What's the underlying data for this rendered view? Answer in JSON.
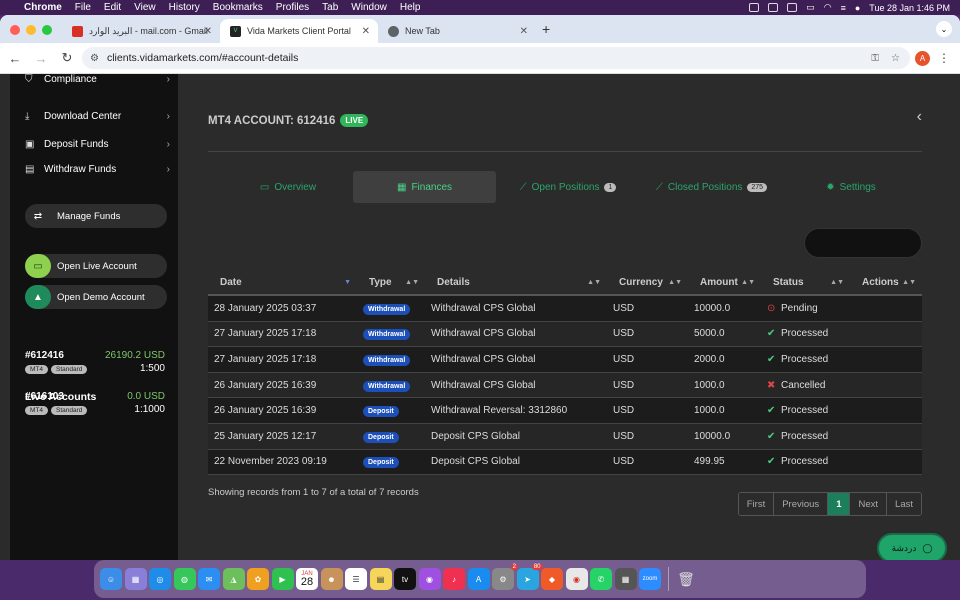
{
  "menubar": {
    "app": "Chrome",
    "items": [
      "File",
      "Edit",
      "View",
      "History",
      "Bookmarks",
      "Profiles",
      "Tab",
      "Window",
      "Help"
    ],
    "clock": "Tue 28 Jan  1:46 PM"
  },
  "browser": {
    "tabs": [
      {
        "title": "البريد الوارد - mail.com - Gmail",
        "favicon_color": "#d93025"
      },
      {
        "title": "Vida Markets Client Portal",
        "favicon_color": "#222222"
      },
      {
        "title": "New Tab",
        "favicon_color": "#5f6368"
      }
    ],
    "url": "clients.vidamarkets.com/#account-details",
    "profile_initial": "A"
  },
  "sidebar": {
    "links": [
      {
        "label": "Compliance",
        "icon": "shield-icon"
      },
      {
        "label": "Download Center",
        "icon": "download-icon"
      },
      {
        "label": "Deposit Funds",
        "icon": "deposit-icon"
      },
      {
        "label": "Withdraw Funds",
        "icon": "withdraw-icon"
      }
    ],
    "manage_funds": "Manage Funds",
    "open_live": "Open Live Account",
    "open_demo": "Open Demo Account",
    "live_accounts_title": "Live Accounts",
    "accounts": [
      {
        "number": "#612416",
        "balance": "26190.2 USD",
        "platform": "MT4",
        "type": "Standard",
        "leverage": "1:500"
      },
      {
        "number": "#616103",
        "balance": "0.0 USD",
        "platform": "MT4",
        "type": "Standard",
        "leverage": "1:1000"
      }
    ]
  },
  "main": {
    "account_title": "MT4 ACCOUNT: 612416",
    "live_badge": "LIVE",
    "tabs": [
      {
        "label": "Overview",
        "icon": "monitor-icon"
      },
      {
        "label": "Finances",
        "icon": "calculator-icon"
      },
      {
        "label": "Open Positions",
        "icon": "chart-icon",
        "count": "1"
      },
      {
        "label": "Closed Positions",
        "icon": "chart-icon",
        "count": "275"
      },
      {
        "label": "Settings",
        "icon": "gear-icon"
      }
    ],
    "table": {
      "columns": [
        "Date",
        "Type",
        "Details",
        "Currency",
        "Amount",
        "Status",
        "Actions"
      ],
      "rows": [
        {
          "date": "28 January 2025 03:37",
          "type": "Withdrawal",
          "details": "Withdrawal CPS Global",
          "currency": "USD",
          "amount": "10000.0",
          "status": "Pending",
          "status_kind": "pending"
        },
        {
          "date": "27 January 2025 17:18",
          "type": "Withdrawal",
          "details": "Withdrawal CPS Global",
          "currency": "USD",
          "amount": "5000.0",
          "status": "Processed",
          "status_kind": "ok"
        },
        {
          "date": "27 January 2025 17:18",
          "type": "Withdrawal",
          "details": "Withdrawal CPS Global",
          "currency": "USD",
          "amount": "2000.0",
          "status": "Processed",
          "status_kind": "ok"
        },
        {
          "date": "26 January 2025 16:39",
          "type": "Withdrawal",
          "details": "Withdrawal CPS Global",
          "currency": "USD",
          "amount": "1000.0",
          "status": "Cancelled",
          "status_kind": "cancel"
        },
        {
          "date": "26 January 2025 16:39",
          "type": "Deposit",
          "details": "Withdrawal Reversal: 3312860",
          "currency": "USD",
          "amount": "1000.0",
          "status": "Processed",
          "status_kind": "ok"
        },
        {
          "date": "25 January 2025 12:17",
          "type": "Deposit",
          "details": "Deposit CPS Global",
          "currency": "USD",
          "amount": "10000.0",
          "status": "Processed",
          "status_kind": "ok"
        },
        {
          "date": "22 November 2023 09:19",
          "type": "Deposit",
          "details": "Deposit CPS Global",
          "currency": "USD",
          "amount": "499.95",
          "status": "Processed",
          "status_kind": "ok"
        }
      ]
    },
    "records_text": "Showing records from 1 to 7 of a total of 7 records",
    "pager": {
      "first": "First",
      "previous": "Previous",
      "current": "1",
      "next": "Next",
      "last": "Last"
    },
    "chat_label": "دردشة"
  },
  "colors": {
    "accent": "#2aa56b",
    "live": "#31b55a",
    "badge": "#1d4fb8",
    "ok": "#4bd07c",
    "error": "#e04545"
  },
  "dock": {
    "calendar_month": "JAN",
    "calendar_day": "28",
    "settings_badge": "2",
    "telegram_badge": "80",
    "zoom_label": "zoom"
  }
}
